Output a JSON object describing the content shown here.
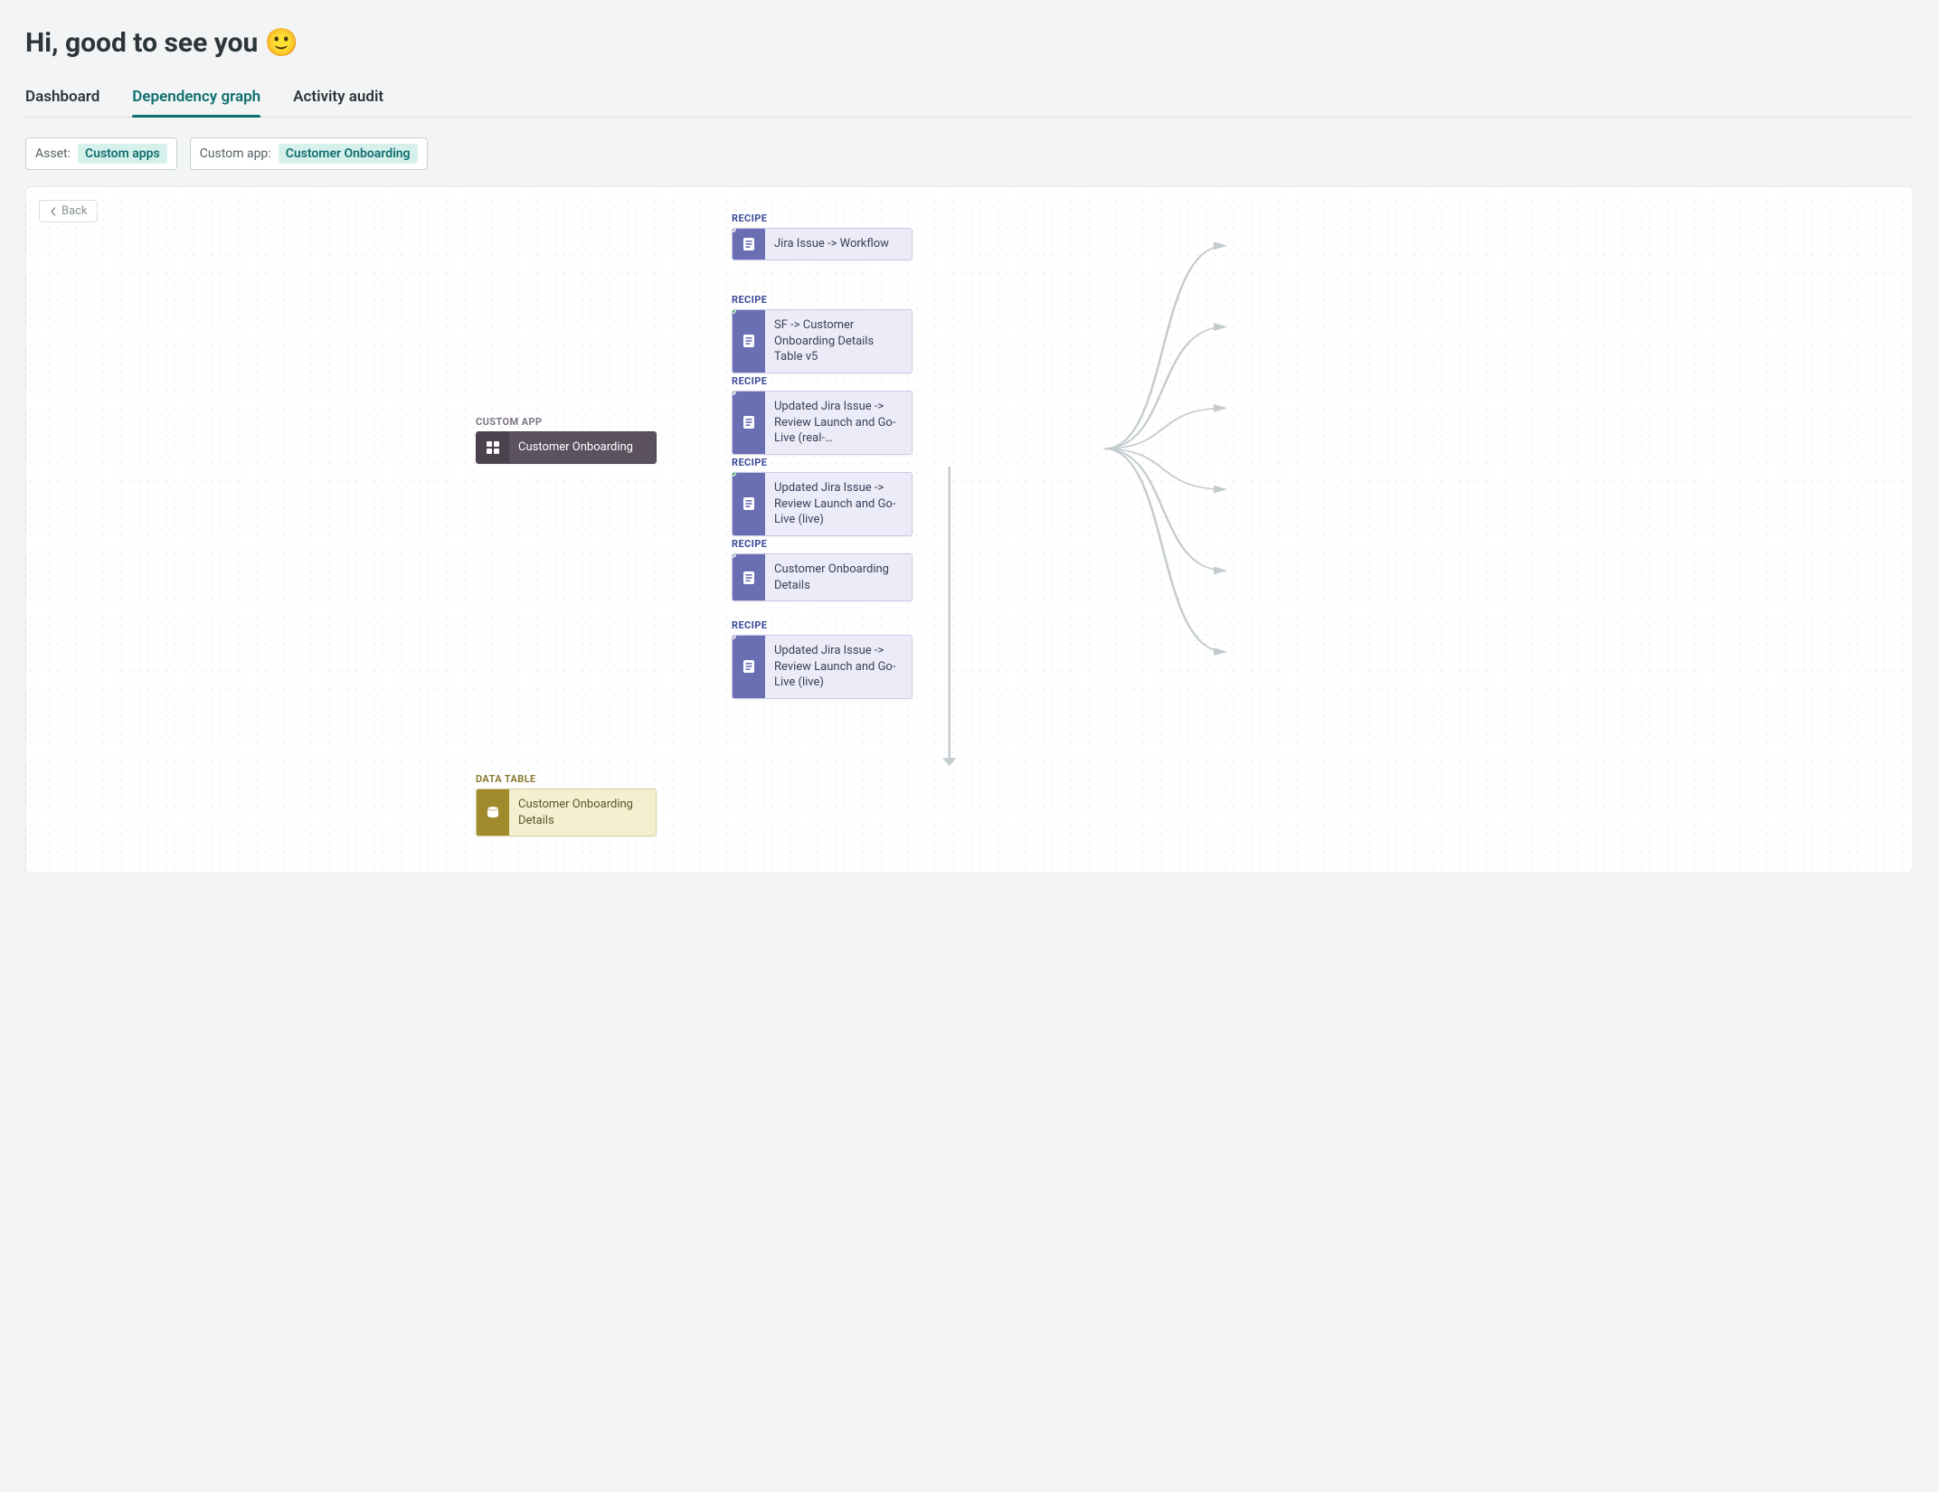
{
  "header": {
    "greeting": "Hi, good to see you 🙂"
  },
  "tabs": [
    {
      "label": "Dashboard",
      "active": false
    },
    {
      "label": "Dependency graph",
      "active": true
    },
    {
      "label": "Activity audit",
      "active": false
    }
  ],
  "filters": {
    "asset": {
      "label": "Asset:",
      "value": "Custom apps"
    },
    "custom_app": {
      "label": "Custom app:",
      "value": "Customer Onboarding"
    }
  },
  "back_button": "Back",
  "graph": {
    "root": {
      "type_label": "CUSTOM APP",
      "title": "Customer Onboarding"
    },
    "data_table": {
      "type_label": "DATA TABLE",
      "title": "Customer Onboarding Details"
    },
    "recipe_type_label": "RECIPE",
    "recipes": [
      {
        "title": "Jira Issue -> Workflow",
        "status": "grey"
      },
      {
        "title": "SF -> Customer Onboarding Details Table v5",
        "status": "green"
      },
      {
        "title": "Updated Jira Issue -> Review Launch and Go-Live (real-…",
        "status": "grey"
      },
      {
        "title": "Updated Jira Issue -> Review Launch and Go-Live (live)",
        "status": "green"
      },
      {
        "title": "Customer Onboarding Details",
        "status": "grey"
      },
      {
        "title": "Updated Jira Issue -> Review Launch and Go-Live (live)",
        "status": "grey"
      }
    ]
  }
}
